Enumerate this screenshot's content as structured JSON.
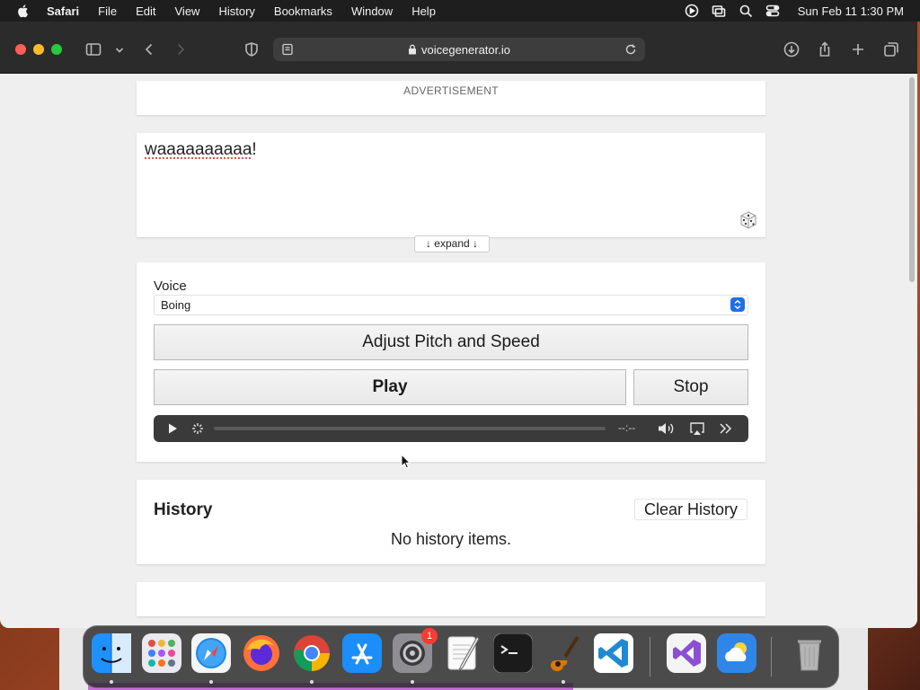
{
  "menubar": {
    "app": "Safari",
    "items": [
      "File",
      "Edit",
      "View",
      "History",
      "Bookmarks",
      "Window",
      "Help"
    ],
    "clock": "Sun Feb 11  1:30 PM"
  },
  "browser": {
    "url": "voicegenerator.io"
  },
  "page": {
    "ad_label": "ADVERTISEMENT",
    "text_prefix": "waaaaaaaaaa",
    "text_suffix": "!",
    "expand_label": "↓ expand ↓",
    "voice_label": "Voice",
    "voice_value": "Boing",
    "adjust_label": "Adjust Pitch and Speed",
    "play_label": "Play",
    "stop_label": "Stop",
    "player_time": "--:--",
    "history_title": "History",
    "clear_label": "Clear History",
    "history_empty": "No history items."
  },
  "dock": {
    "apps": [
      "finder",
      "launchpad",
      "safari",
      "firefox",
      "chrome",
      "app-store",
      "system-settings",
      "textedit",
      "terminal",
      "garageband",
      "vscode",
      "visual-studio",
      "weather",
      "trash"
    ],
    "settings_badge": "1"
  }
}
